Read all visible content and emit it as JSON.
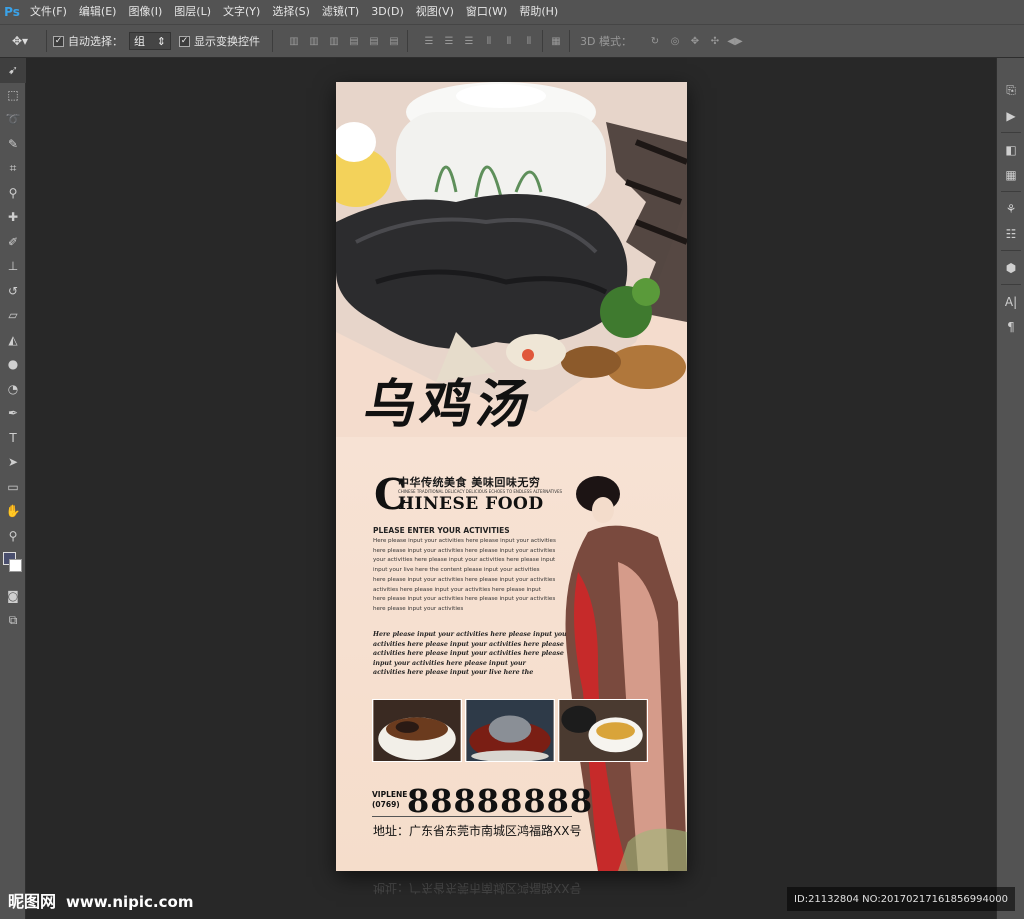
{
  "app": {
    "logo": "Ps"
  },
  "menu": [
    "文件(F)",
    "编辑(E)",
    "图像(I)",
    "图层(L)",
    "文字(Y)",
    "选择(S)",
    "滤镜(T)",
    "3D(D)",
    "视图(V)",
    "窗口(W)",
    "帮助(H)"
  ],
  "options": {
    "auto_select_label": "自动选择：",
    "auto_select_value": "组",
    "show_transform_label": "显示变换控件",
    "mode_3d_label": "3D 模式："
  },
  "tools": [
    "move-tool",
    "marquee-tool",
    "lasso-tool",
    "quick-select-tool",
    "crop-tool",
    "eyedropper-tool",
    "healing-brush-tool",
    "brush-tool",
    "clone-stamp-tool",
    "history-brush-tool",
    "eraser-tool",
    "paint-bucket-tool",
    "blur-tool",
    "dodge-tool",
    "pen-tool",
    "type-tool",
    "path-select-tool",
    "shape-tool",
    "hand-tool",
    "zoom-tool"
  ],
  "poster": {
    "title": "乌鸡汤",
    "subtitle_cn": "中华传统美食  美味回味无穷",
    "subtitle_tiny": "CHINESE TRADITIONAL DELICACY DELICIOUS ECHOES TO ENDLESS ALTERNATIVES",
    "big_c": "C",
    "chinese_food": "HINESE FOOD",
    "activities_title": "PLEASE ENTER YOUR ACTIVITIES",
    "body_lines": [
      "Here please input your activities here please input your activities",
      "here please input your activities here please input your activities",
      "your activities here please input your activities here please input",
      "input your live here the content please input your activities",
      "here please input your activities here please input your activities",
      " activities here please input your activities here please input",
      "here please input your activities here please input your activities",
      "here please input your activities"
    ],
    "script_lines": [
      "Here please input your activities here please input your",
      "activities here please input your activities here please",
      "activities here please input your activities here please",
      "input your activities here please input your",
      "activities here please input your live here the"
    ],
    "vip_line1": "VIPLENE",
    "vip_line2": "(0769)",
    "phone": "88888888",
    "address": "地址：广东省东莞市南城区鸿福路XX号"
  },
  "watermark": {
    "site_cn": "昵图网",
    "site_url": "www.nipic.com",
    "id_text": "ID:21132804 NO:20170217161856994000"
  }
}
